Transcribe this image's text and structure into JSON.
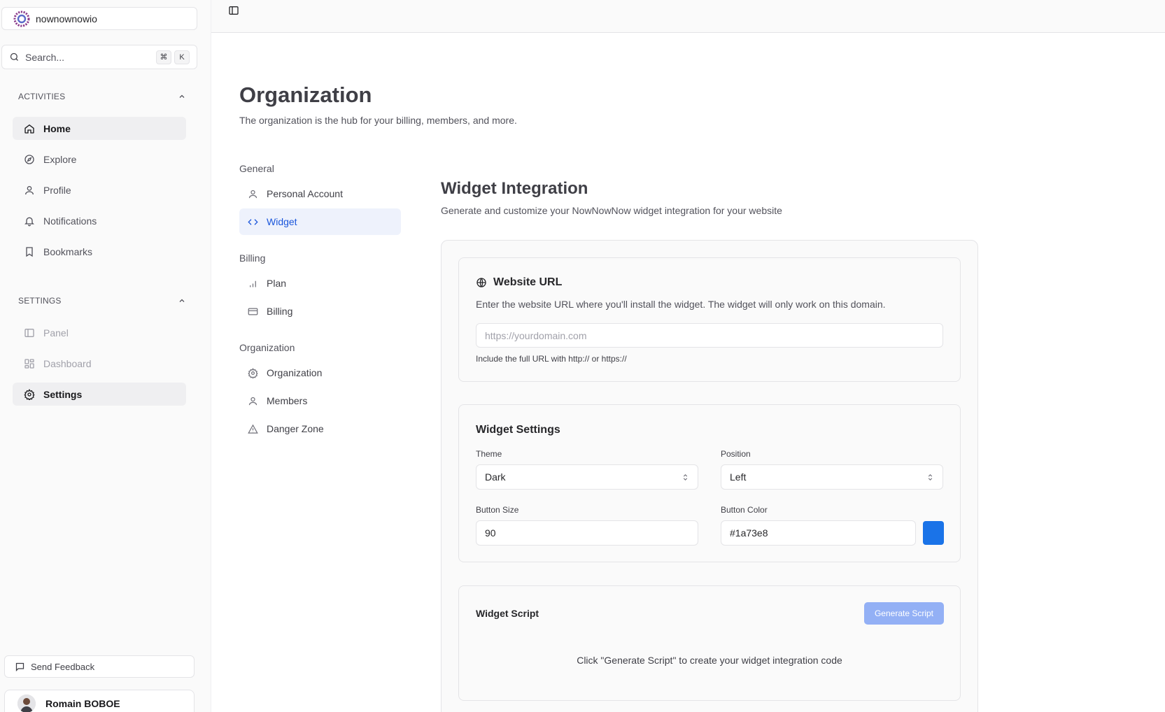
{
  "sidebar": {
    "org_name": "nownownowio",
    "search_placeholder": "Search...",
    "shortcut_keys": [
      "⌘",
      "K"
    ],
    "activities_label": "ACTIVITIES",
    "activities": [
      {
        "label": "Home",
        "icon": "home-icon",
        "active": true
      },
      {
        "label": "Explore",
        "icon": "compass-icon"
      },
      {
        "label": "Profile",
        "icon": "user-icon"
      },
      {
        "label": "Notifications",
        "icon": "bell-icon"
      },
      {
        "label": "Bookmarks",
        "icon": "bookmark-icon"
      }
    ],
    "settings_label": "SETTINGS",
    "settings": [
      {
        "label": "Panel",
        "icon": "panel-icon",
        "disabled": true
      },
      {
        "label": "Dashboard",
        "icon": "dashboard-icon",
        "disabled": true
      },
      {
        "label": "Settings",
        "icon": "gear-icon",
        "active": true
      }
    ],
    "feedback_label": "Send Feedback",
    "user_name": "Romain BOBOE"
  },
  "page": {
    "title": "Organization",
    "subtitle": "The organization is the hub for your billing, members, and more."
  },
  "subnav": {
    "groups": [
      {
        "label": "General",
        "items": [
          {
            "label": "Personal Account",
            "icon": "user-icon"
          },
          {
            "label": "Widget",
            "icon": "code-icon",
            "active": true
          }
        ]
      },
      {
        "label": "Billing",
        "items": [
          {
            "label": "Plan",
            "icon": "bar-chart-icon"
          },
          {
            "label": "Billing",
            "icon": "credit-card-icon"
          }
        ]
      },
      {
        "label": "Organization",
        "items": [
          {
            "label": "Organization",
            "icon": "gear-icon"
          },
          {
            "label": "Members",
            "icon": "user-icon"
          },
          {
            "label": "Danger Zone",
            "icon": "warning-icon"
          }
        ]
      }
    ]
  },
  "widget": {
    "title": "Widget Integration",
    "subtitle": "Generate and customize your NowNowNow widget integration for your website",
    "url_card": {
      "title": "Website URL",
      "description": "Enter the website URL where you'll install the widget. The widget will only work on this domain.",
      "placeholder": "https://yourdomain.com",
      "hint": "Include the full URL with http:// or https://"
    },
    "settings_card": {
      "title": "Widget Settings",
      "theme_label": "Theme",
      "theme_value": "Dark",
      "position_label": "Position",
      "position_value": "Left",
      "size_label": "Button Size",
      "size_value": "90",
      "color_label": "Button Color",
      "color_value": "#1a73e8"
    },
    "script_card": {
      "title": "Widget Script",
      "button_label": "Generate Script",
      "hint": "Click \"Generate Script\" to create your widget integration code"
    }
  },
  "colors": {
    "accent": "#1a56db",
    "button_color": "#1a73e8",
    "generate_button": "#93b0f5"
  }
}
